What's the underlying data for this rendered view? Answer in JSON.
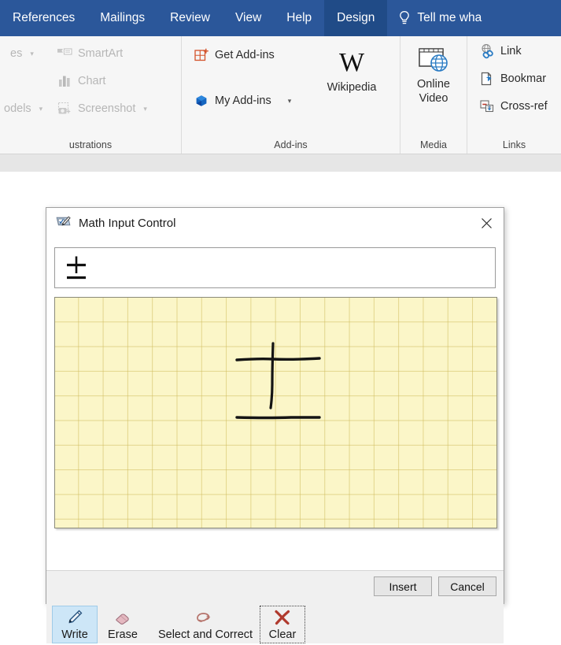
{
  "ribbon": {
    "tabs": [
      {
        "label": "References",
        "active": false
      },
      {
        "label": "Mailings",
        "active": false
      },
      {
        "label": "Review",
        "active": false
      },
      {
        "label": "View",
        "active": false
      },
      {
        "label": "Help",
        "active": false
      },
      {
        "label": "Design",
        "active": true
      }
    ],
    "tell_me": "Tell me wha",
    "tell_me_icon": "lightbulb-icon",
    "groups": [
      {
        "label": "ustrations",
        "full_label": "Illustrations",
        "items": [
          {
            "label": "es",
            "icon": "shapes-icon",
            "disabled": true,
            "has_caret": true
          },
          {
            "label": "odels",
            "icon": "3d-models-icon",
            "disabled": true,
            "has_caret": true
          },
          {
            "label": "SmartArt",
            "icon": "smartart-icon",
            "disabled": true,
            "has_caret": false
          },
          {
            "label": "Chart",
            "icon": "chart-icon",
            "disabled": true,
            "has_caret": false
          },
          {
            "label": "Screenshot",
            "icon": "screenshot-icon",
            "disabled": true,
            "has_caret": true
          }
        ]
      },
      {
        "label": "Add-ins",
        "items": [
          {
            "label": "Get Add-ins",
            "icon": "get-addins-icon",
            "disabled": false,
            "has_caret": false
          },
          {
            "label": "My Add-ins",
            "icon": "my-addins-icon",
            "disabled": false,
            "has_caret": true
          },
          {
            "label": "Wikipedia",
            "icon": "wikipedia-icon",
            "disabled": false,
            "has_caret": false
          }
        ]
      },
      {
        "label": "Media",
        "items": [
          {
            "label": "Online Video",
            "icon": "online-video-icon",
            "disabled": false,
            "has_caret": false
          }
        ]
      },
      {
        "label": "Links",
        "items": [
          {
            "label": "Link",
            "icon": "link-icon",
            "disabled": false,
            "has_caret": false
          },
          {
            "label": "Bookmar",
            "full_label": "Bookmark",
            "icon": "bookmark-icon",
            "disabled": false,
            "has_caret": false
          },
          {
            "label": "Cross-ref",
            "full_label": "Cross-reference",
            "icon": "cross-reference-icon",
            "disabled": false,
            "has_caret": false
          }
        ]
      }
    ]
  },
  "dialog": {
    "title": "Math Input Control",
    "title_icon": "math-input-tablet-icon",
    "close_icon": "close-icon",
    "preview": {
      "recognized_symbol": "±",
      "name": "plus-minus-symbol"
    },
    "canvas": {
      "name": "ink-writing-canvas",
      "grid": "on",
      "background_color": "#fbf6c8",
      "grid_color": "#cdba5a",
      "ink_color": "#111111",
      "strokes_description": "handwritten plus-minus sign"
    },
    "tools": [
      {
        "label": "Write",
        "icon": "pen-icon",
        "selected": true,
        "focused": false
      },
      {
        "label": "Erase",
        "icon": "eraser-icon",
        "selected": false,
        "focused": false
      },
      {
        "label": "Select and Correct",
        "icon": "lasso-icon",
        "selected": false,
        "focused": false
      },
      {
        "label": "Clear",
        "icon": "clear-x-icon",
        "selected": false,
        "focused": true
      }
    ],
    "footer": {
      "insert_label": "Insert",
      "cancel_label": "Cancel"
    }
  },
  "colors": {
    "ribbon_blue": "#2b579a",
    "ribbon_active_tab": "#204b87",
    "selected_tool": "#cde6f7",
    "canvas_yellow": "#fbf6c8"
  }
}
